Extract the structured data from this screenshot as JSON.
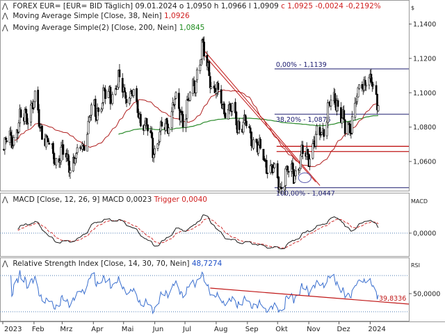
{
  "header": {
    "instrument": "FOREX EUR= [EUR= BID Täglich]",
    "date": "09.01.2024",
    "o": "o 1,0950",
    "h": "h 1,0966",
    "l": "l 1,0909",
    "c": "c 1,0925",
    "chg": "-0,0024",
    "chg_pct": "-0,2192%",
    "ma1_label": "Moving Average Simple [Close, 38, Nein]",
    "ma1_value": "1,0926",
    "ma2_label": "Moving Average Simple(2) [Close, 200, Nein]",
    "ma2_value": "1,0845",
    "macd_label": "MACD [Close, 12, 26, 9]",
    "macd_value": "MACD 0,0023",
    "trigger_value": "Trigger 0,0040",
    "rsi_label": "Relative Strength Index [Close, 14, 30, 70, Nein]",
    "rsi_value": "48,7274",
    "dollar_sign": "$",
    "macd_axis_title": "MACD",
    "rsi_axis_title": "RSI"
  },
  "colors": {
    "candle_up": "#ffffff",
    "candle_down": "#000000",
    "ma38": "#b02020",
    "ma200": "#2a8a2a",
    "fib": "#1a1a6e",
    "support": "#c01818",
    "rsi": "#3a6fcf",
    "macd": "#1a1a1a",
    "trigger": "#d03030",
    "reference": "#4a7ab0"
  },
  "chart_data": [
    {
      "type": "candlestick",
      "title": "FOREX EUR= [EUR= BID Täglich]",
      "x_ticks": [
        "2023",
        "Feb",
        "Mrz",
        "Apr",
        "Mai",
        "Jun",
        "Jul",
        "Aug",
        "Sep",
        "Okt",
        "Nov",
        "Dez",
        "2024"
      ],
      "y_ticks": [
        "1,1400",
        "1,1200",
        "1,1000",
        "1,0800",
        "1,0600"
      ],
      "ylim": [
        1.043,
        1.154
      ],
      "last_close": 1.0925,
      "ma38_last": 1.0926,
      "ma200_last": 1.0845,
      "fibonacci": [
        {
          "label": "0,00% - 1,1139",
          "value": 1.1139
        },
        {
          "label": "38,20% - 1,0875",
          "value": 1.0875
        },
        {
          "label": "100,00% - 1,0447",
          "value": 1.0447
        }
      ],
      "support_band": [
        1.0658,
        1.0688
      ],
      "path_key_points": [
        [
          "Jan 02",
          1.067
        ],
        [
          "Jan 26",
          1.09
        ],
        [
          "Feb 02",
          1.093
        ],
        [
          "Feb 17",
          1.065
        ],
        [
          "Mar 15",
          1.06
        ],
        [
          "Mar 31",
          1.088
        ],
        [
          "Apr 26",
          1.105
        ],
        [
          "May 10",
          1.098
        ],
        [
          "May 31",
          1.068
        ],
        [
          "Jun 20",
          1.092
        ],
        [
          "Jul 01",
          1.086
        ],
        [
          "Jul 18",
          1.124
        ],
        [
          "Aug 01",
          1.099
        ],
        [
          "Aug 15",
          1.088
        ],
        [
          "Sep 01",
          1.078
        ],
        [
          "Oct 03",
          1.047
        ],
        [
          "Oct 18",
          1.056
        ],
        [
          "Nov 07",
          1.07
        ],
        [
          "Nov 28",
          1.098
        ],
        [
          "Dec 08",
          1.076
        ],
        [
          "Dec 28",
          1.111
        ],
        [
          "Jan 09",
          1.0925
        ]
      ]
    },
    {
      "type": "line",
      "title": "MACD [Close, 12, 26, 9]",
      "y_ticks": [
        "0,0000"
      ],
      "series": [
        {
          "name": "MACD",
          "last": 0.0023
        },
        {
          "name": "Trigger",
          "last": 0.004
        }
      ]
    },
    {
      "type": "line",
      "title": "Relative Strength Index [Close, 14, 30, 70, Nein]",
      "y_ticks": [
        "50,0000"
      ],
      "series": [
        {
          "name": "RSI",
          "last": 48.7274
        }
      ],
      "trendline_end_label": "39,8336"
    }
  ]
}
